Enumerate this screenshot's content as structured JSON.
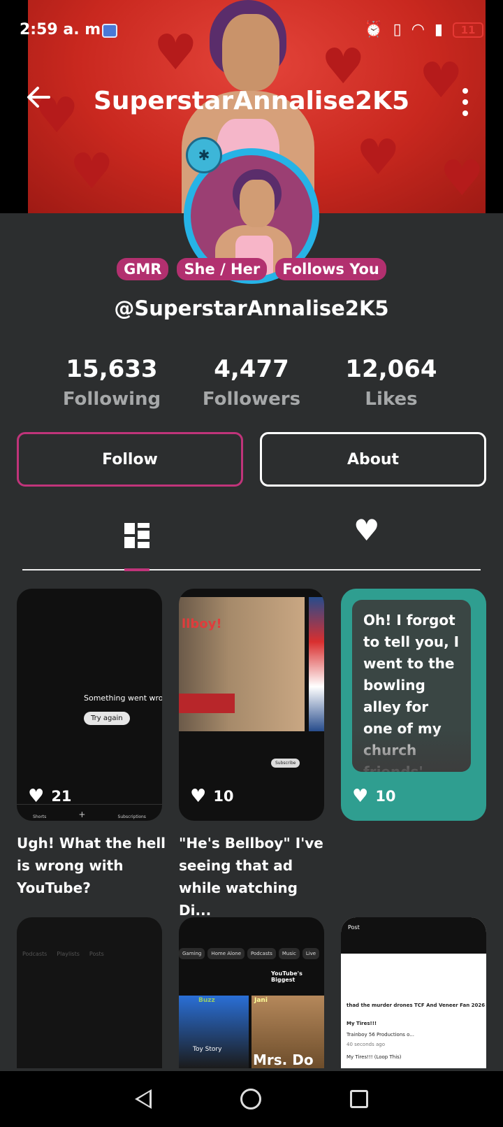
{
  "status_bar": {
    "time": "2:59 a. m.",
    "battery": "11"
  },
  "header": {
    "title": "SuperstarAnnalise2K5"
  },
  "profile": {
    "tags": [
      "GMR",
      "She / Her",
      "Follows You"
    ],
    "handle": "@SuperstarAnnalise2K5",
    "stats": [
      {
        "value": "15,633",
        "label": "Following"
      },
      {
        "value": "4,477",
        "label": "Followers"
      },
      {
        "value": "12,064",
        "label": "Likes"
      }
    ],
    "follow_label": "Follow",
    "about_label": "About"
  },
  "posts": [
    {
      "likes": "21",
      "caption": "Ugh! What the hell is wrong with YouTube?",
      "thumb_error": "Something went wro",
      "thumb_retry": "Try again",
      "thumb_nav": [
        "Shorts",
        "+",
        "Subscriptions"
      ]
    },
    {
      "likes": "10",
      "caption": "\"He's Bellboy\" I've seeing that ad while watching Di...",
      "thumb_sign": "llboy!",
      "thumb_subscribe": "Subscribe"
    },
    {
      "likes": "10",
      "caption": "",
      "text_post": "Oh! I forgot to tell you, I went to the bowling alley for one of my church friends'"
    },
    {
      "thumb_tabs": [
        "Podcasts",
        "Playlists",
        "Posts"
      ]
    },
    {
      "thumb_chips": [
        "Gaming",
        "Home Alone",
        "Podcasts",
        "Music",
        "Live"
      ],
      "thumb_title": "YouTube's Biggest",
      "thumb_labels": [
        "Buzz",
        "Jani",
        "Toy Story",
        "Mrs. Do"
      ]
    },
    {
      "thumb_header": "Post",
      "thumb_lines": [
        "thad the murder drones TCF And Veneer Fan 2026",
        "My Tires!!!",
        "Trainboy 56 Productions o...",
        "40 seconds ago",
        "My Tires!!! (Loop This)"
      ]
    }
  ]
}
